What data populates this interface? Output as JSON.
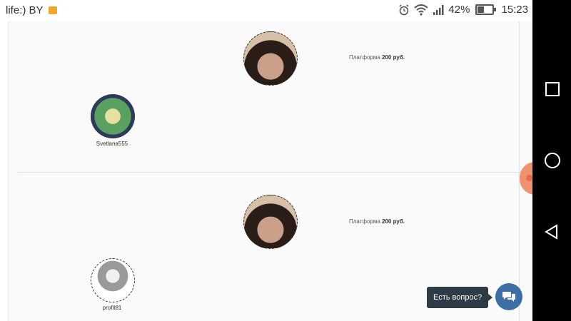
{
  "status_bar": {
    "carrier": "life:) BY",
    "battery": "42%",
    "time": "15:23"
  },
  "cards": [
    {
      "price_label": "Платформа",
      "price_value": "200 руб.",
      "username": "Svetlana555"
    },
    {
      "price_label": "Платформа",
      "price_value": "200 руб.",
      "username": "profit81"
    }
  ],
  "chat": {
    "tooltip": "Есть вопрос?"
  },
  "colors": {
    "chat_button": "#3d6fa5",
    "tooltip_bg": "#2d3b46",
    "side_tab": "#f07f55"
  }
}
